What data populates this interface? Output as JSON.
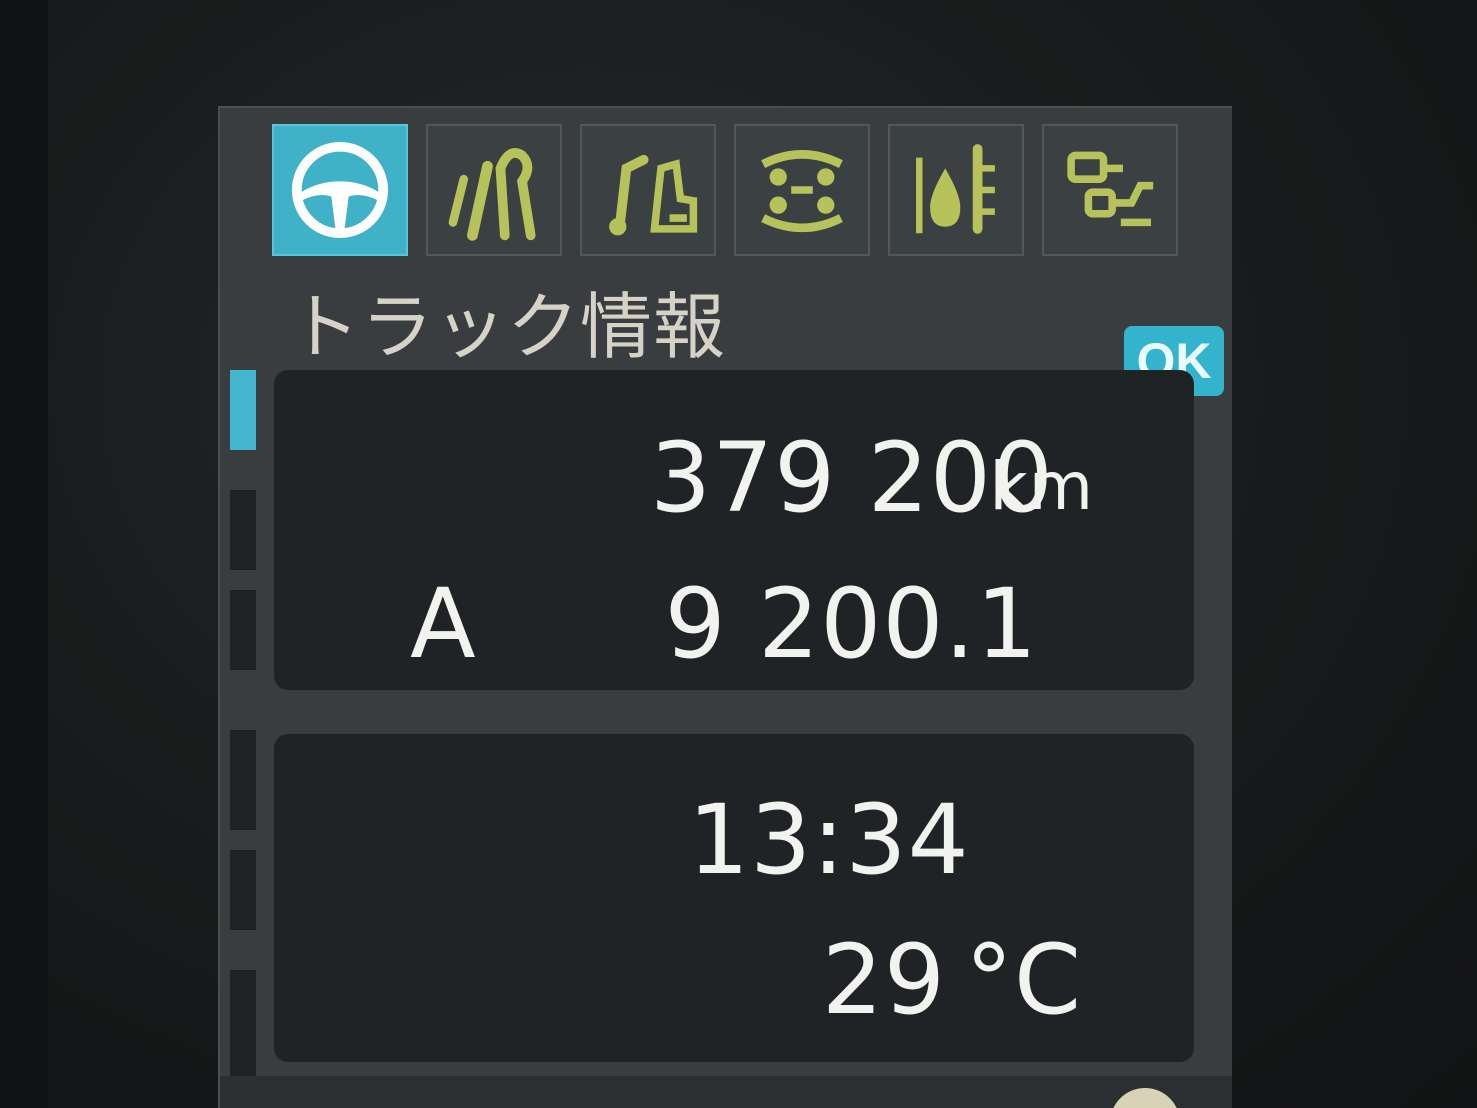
{
  "screen": {
    "title": "トラック情報",
    "ok_label": "OK"
  },
  "tabs": [
    {
      "icon": "steering-wheel-icon",
      "active": true
    },
    {
      "icon": "road-lane-icon",
      "active": false
    },
    {
      "icon": "music-note-icon",
      "active": false
    },
    {
      "icon": "vehicle-top-view-icon",
      "active": false
    },
    {
      "icon": "fluid-level-icon",
      "active": false
    },
    {
      "icon": "settings-sliders-icon",
      "active": false
    }
  ],
  "trip_panel": {
    "odometer_value": "379 200",
    "odometer_unit": "km",
    "trip_label": "A",
    "trip_value": "9 200.1"
  },
  "info_panel": {
    "time": "13:34",
    "temperature_value": "29",
    "temperature_unit": "°C"
  },
  "colors": {
    "accent": "#3fb2c8",
    "text": "#f2f2ee",
    "icon_inactive": "#b8c25a",
    "panel_bg": "#202325",
    "screen_bg": "#3a3d3f"
  }
}
